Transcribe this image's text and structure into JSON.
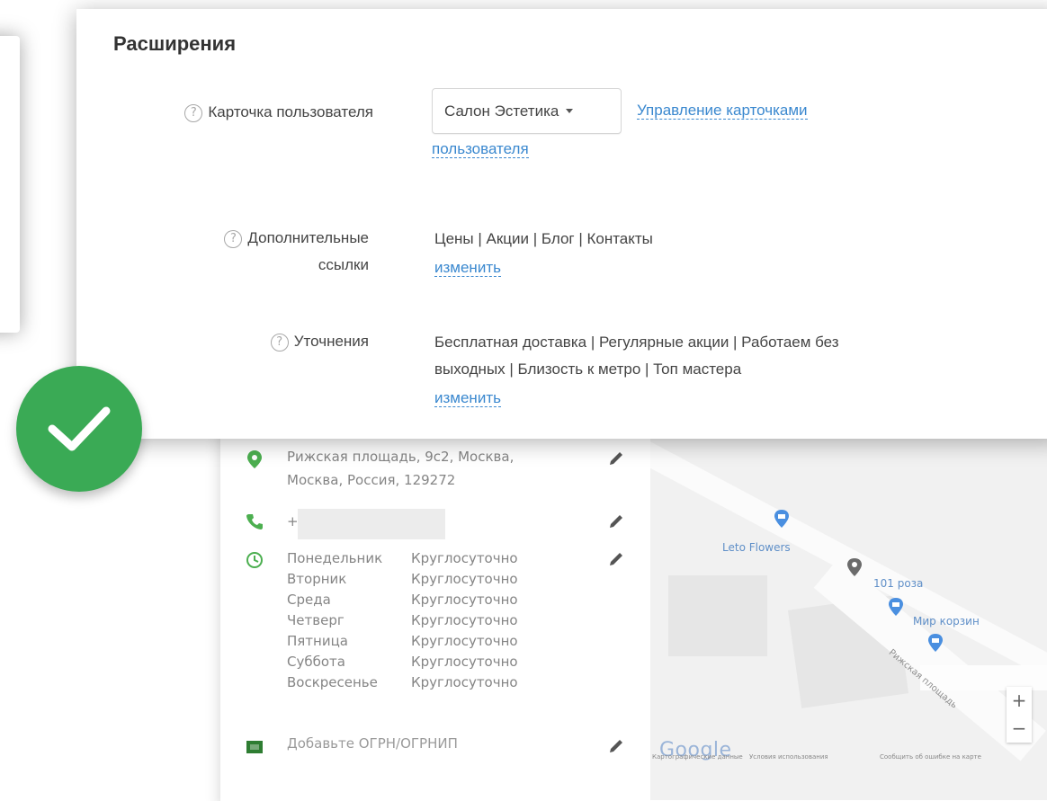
{
  "extensions": {
    "title": "Расширения",
    "user_card": {
      "label": "Карточка пользователя",
      "selected": "Салон Эстетика",
      "manage_link": "Управление карточками",
      "manage_link_cont": "пользователя"
    },
    "extra_links": {
      "label_line1": "Дополнительные",
      "label_line2": "ссылки",
      "value": "Цены | Акции | Блог | Контакты",
      "edit_link": "изменить"
    },
    "clarifications": {
      "label": "Уточнения",
      "value_line1": "Бесплатная доставка | Регулярные акции | Работаем без",
      "value_line2": "выходных | Близость к метро | Топ мастера",
      "edit_link": "изменить"
    }
  },
  "business_card": {
    "address_line1": "Рижская площадь, 9с2, Москва,",
    "address_line2": "Москва, Россия, 129272",
    "phone_prefix": "+",
    "hours": [
      {
        "day": "Понедельник",
        "time": "Круглосуточно"
      },
      {
        "day": "Вторник",
        "time": "Круглосуточно"
      },
      {
        "day": "Среда",
        "time": "Круглосуточно"
      },
      {
        "day": "Четверг",
        "time": "Круглосуточно"
      },
      {
        "day": "Пятница",
        "time": "Круглосуточно"
      },
      {
        "day": "Суббота",
        "time": "Круглосуточно"
      },
      {
        "day": "Воскресенье",
        "time": "Круглосуточно"
      }
    ],
    "ogrn_prompt": "Добавьте ОГРН/ОГРНИП"
  },
  "map": {
    "places": [
      "Leto Flowers",
      "101 роза",
      "Мир корзин"
    ],
    "streets": [
      "Рижская площадь"
    ],
    "zoom_in": "+",
    "zoom_out": "−",
    "logo": "Google",
    "footer": [
      "Картографические данные",
      "Условия использования",
      "Сообщить об ошибке на карте"
    ]
  },
  "colors": {
    "link": "#3a88cf",
    "badge": "#3aaa55",
    "text": "#444444"
  },
  "icons": [
    "help-icon",
    "location-pin-icon",
    "phone-icon",
    "clock-icon",
    "pencil-icon",
    "ogrn-icon",
    "check-icon"
  ]
}
